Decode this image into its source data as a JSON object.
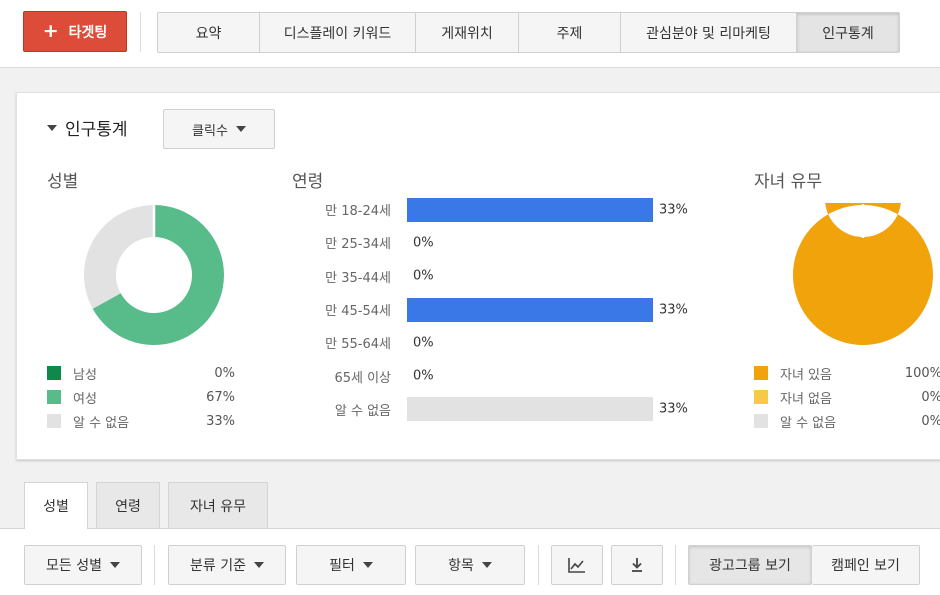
{
  "topbar": {
    "target_button": "타겟팅",
    "tabs": [
      {
        "label": "요약"
      },
      {
        "label": "디스플레이 키워드"
      },
      {
        "label": "게재위치"
      },
      {
        "label": "주제"
      },
      {
        "label": "관심분야 및 리마케팅"
      },
      {
        "label": "인구통계"
      }
    ],
    "active_tab": "인구통계"
  },
  "card": {
    "title": "인구통계",
    "metric_dropdown": "클릭수",
    "gender": {
      "label": "성별",
      "legend": [
        {
          "name": "남성",
          "value": "0%",
          "color": "#0d8a49"
        },
        {
          "name": "여성",
          "value": "67%",
          "color": "#57bb8a"
        },
        {
          "name": "알 수 없음",
          "value": "33%",
          "color": "#e2e2e2"
        }
      ]
    },
    "age": {
      "label": "연령",
      "rows": [
        {
          "name": "만 18-24세",
          "value": "33%"
        },
        {
          "name": "만 25-34세",
          "value": "0%"
        },
        {
          "name": "만 35-44세",
          "value": "0%"
        },
        {
          "name": "만 45-54세",
          "value": "33%"
        },
        {
          "name": "만 55-64세",
          "value": "0%"
        },
        {
          "name": "65세 이상",
          "value": "0%"
        },
        {
          "name": "알 수 없음",
          "value": "33%"
        }
      ]
    },
    "children": {
      "label": "자녀 유무",
      "legend": [
        {
          "name": "자녀 있음",
          "value": "100%",
          "color": "#f0a30a"
        },
        {
          "name": "자녀 없음",
          "value": "0%",
          "color": "#f7c948"
        },
        {
          "name": "알 수 없음",
          "value": "0%",
          "color": "#e2e2e2"
        }
      ]
    }
  },
  "bottom_tabs": [
    {
      "label": "성별"
    },
    {
      "label": "연령"
    },
    {
      "label": "자녀 유무"
    }
  ],
  "toolbar": {
    "all_gender": "모든 성별",
    "segment": "분류 기준",
    "filter": "필터",
    "columns": "항목",
    "view_adgroup": "광고그룹 보기",
    "view_campaign": "캠페인 보기"
  },
  "chart_data": [
    {
      "type": "pie",
      "title": "성별",
      "categories": [
        "남성",
        "여성",
        "알 수 없음"
      ],
      "values": [
        0,
        67,
        33
      ],
      "colors": [
        "#0d8a49",
        "#57bb8a",
        "#e2e2e2"
      ]
    },
    {
      "type": "bar",
      "title": "연령",
      "categories": [
        "만 18-24세",
        "만 25-34세",
        "만 35-44세",
        "만 45-54세",
        "만 55-64세",
        "65세 이상",
        "알 수 없음"
      ],
      "values": [
        33,
        0,
        0,
        33,
        0,
        0,
        33
      ],
      "colors": [
        "#3b78e7",
        "#3b78e7",
        "#3b78e7",
        "#3b78e7",
        "#3b78e7",
        "#3b78e7",
        "#e2e2e2"
      ],
      "ylim": [
        0,
        33
      ]
    },
    {
      "type": "pie",
      "title": "자녀 유무",
      "categories": [
        "자녀 있음",
        "자녀 없음",
        "알 수 없음"
      ],
      "values": [
        100,
        0,
        0
      ],
      "colors": [
        "#f0a30a",
        "#f7c948",
        "#e2e2e2"
      ]
    }
  ]
}
